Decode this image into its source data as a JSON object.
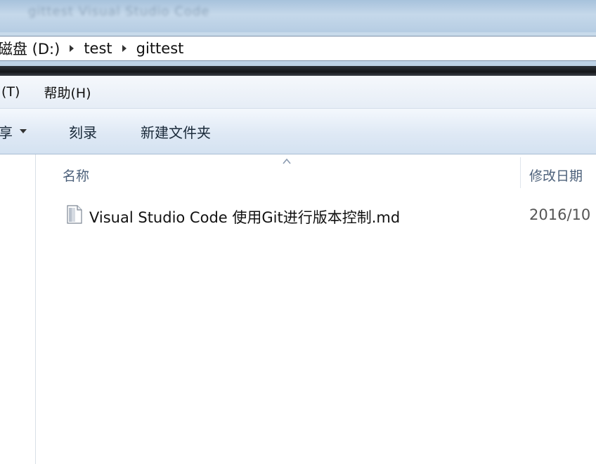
{
  "titlebar": {
    "blurred_title": "gittest   Visual Studio Code"
  },
  "address": {
    "crumbs": [
      "磁盘 (D:)",
      "test",
      "gittest"
    ]
  },
  "menu": {
    "items": [
      "(T)",
      "帮助(H)"
    ]
  },
  "toolbar": {
    "share_label": "享",
    "burn_label": "刻录",
    "new_folder_label": "新建文件夹"
  },
  "columns": {
    "name": "名称",
    "modified": "修改日期"
  },
  "files": [
    {
      "name": "Visual Studio Code 使用Git进行版本控制.md",
      "modified": "2016/10"
    }
  ],
  "colors": {
    "address_border": "#7e93ab",
    "toolbar_text": "#1a2a3a",
    "header_text": "#4c607a"
  }
}
